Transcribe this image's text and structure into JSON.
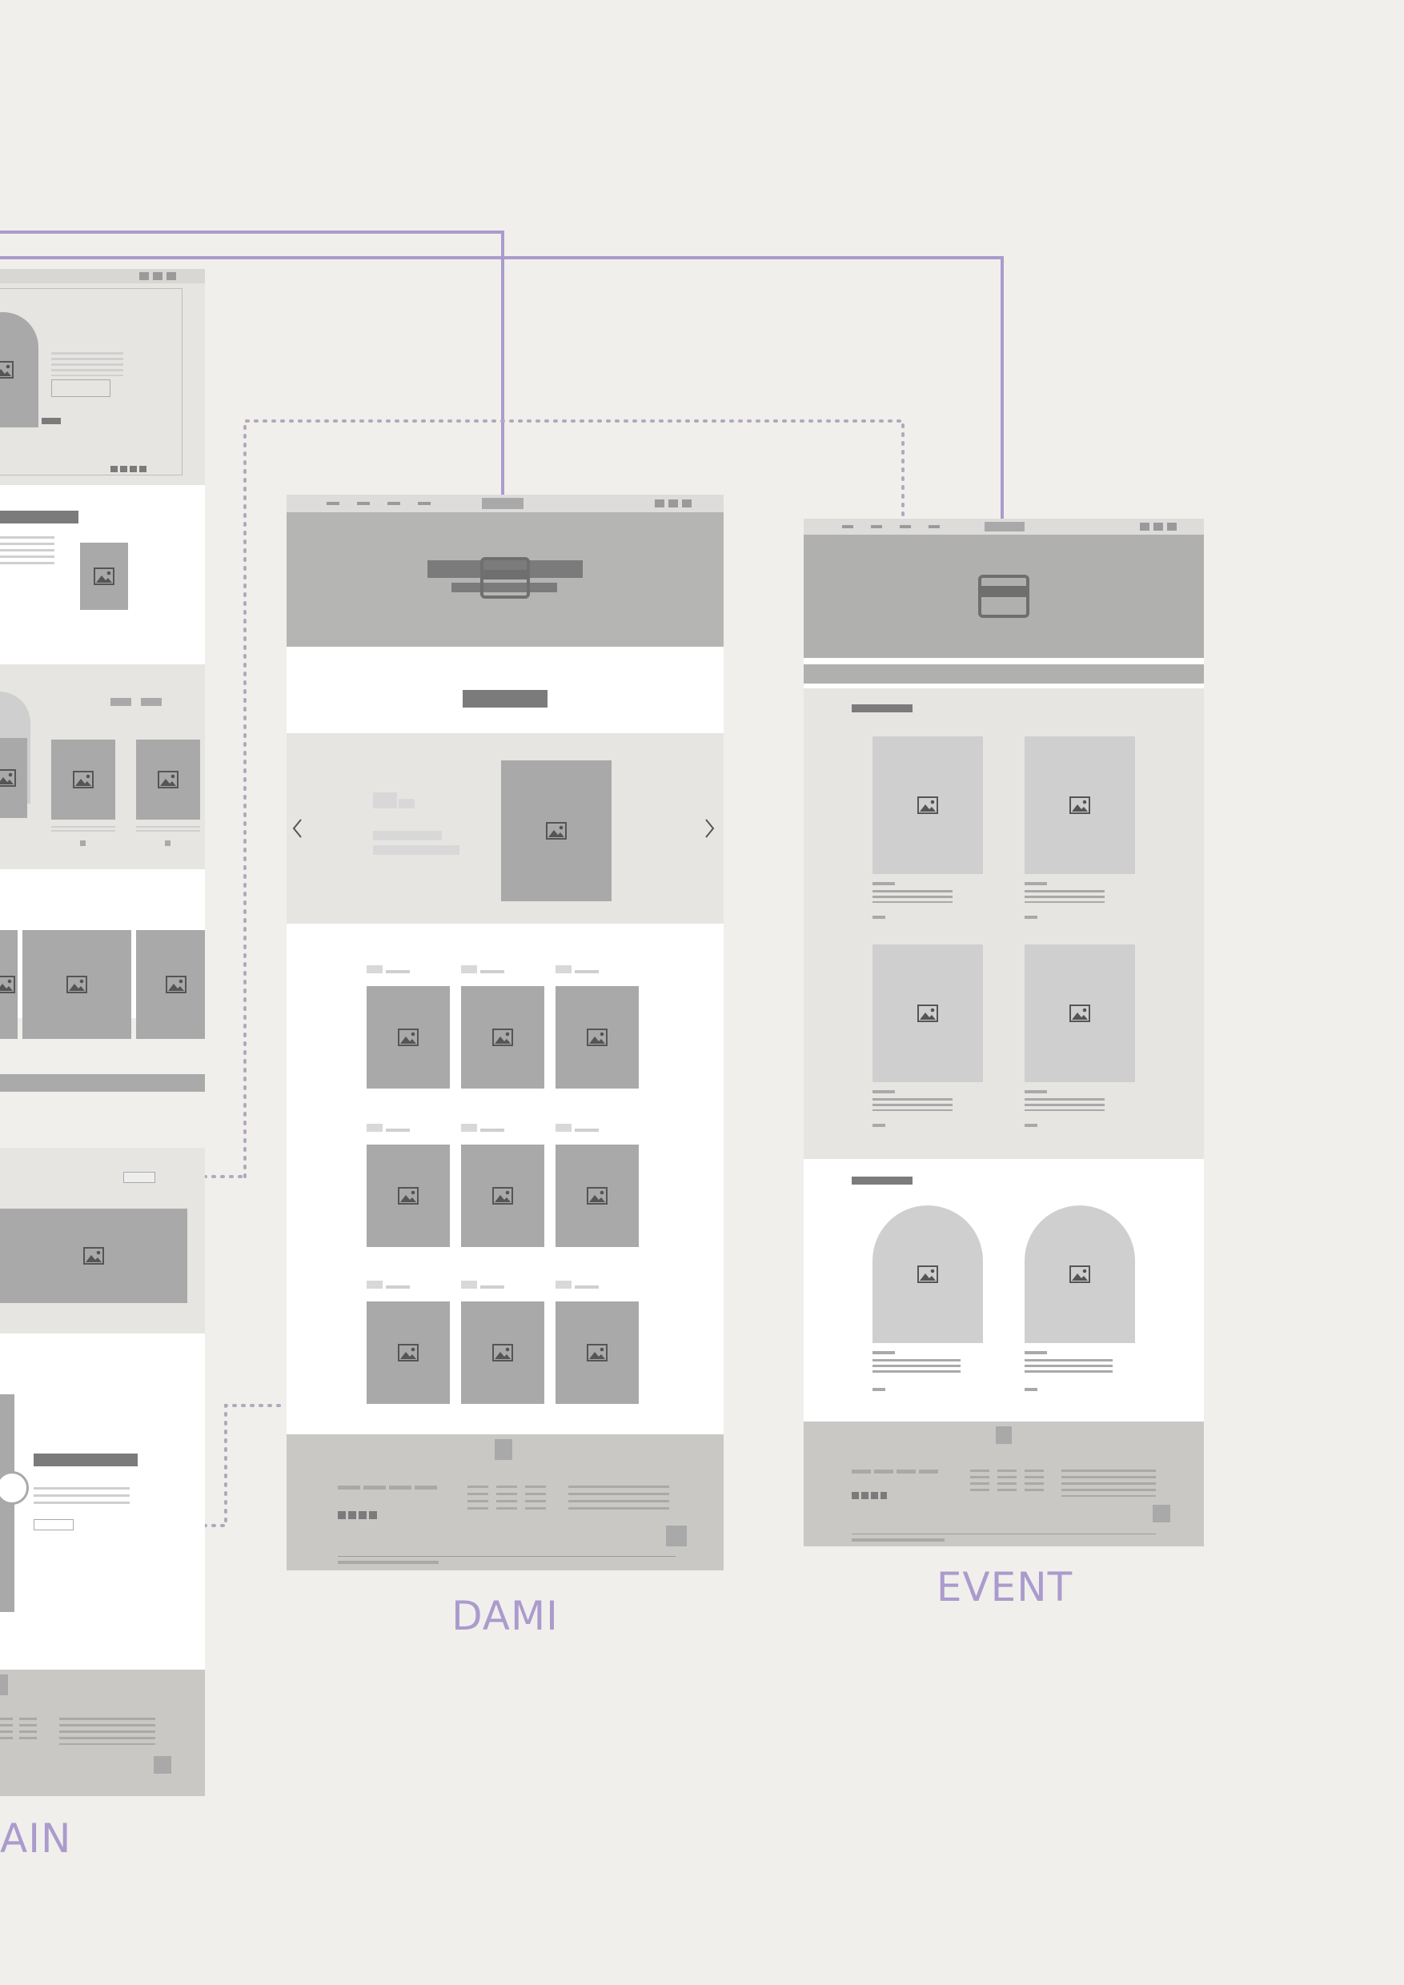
{
  "labels": {
    "main": "AIN",
    "dami": "DAMI",
    "event": "EVENT"
  },
  "icons": {
    "image_placeholder": "image-icon",
    "carousel_prev": "chevron-left-icon",
    "carousel_next": "chevron-right-icon",
    "hero_logo": "bag-logo-icon"
  },
  "colors": {
    "background": "#f1efeb",
    "connector": "#ab9bcd",
    "dotted_connector": "#b2a8be",
    "frame_light": "#e6e5e2",
    "frame_white": "#ffffff",
    "placeholder": "#a9a9a9",
    "placeholder_light": "#cfcfcf",
    "footer": "#c9c8c5",
    "dark_bar": "#7b7b7b"
  }
}
